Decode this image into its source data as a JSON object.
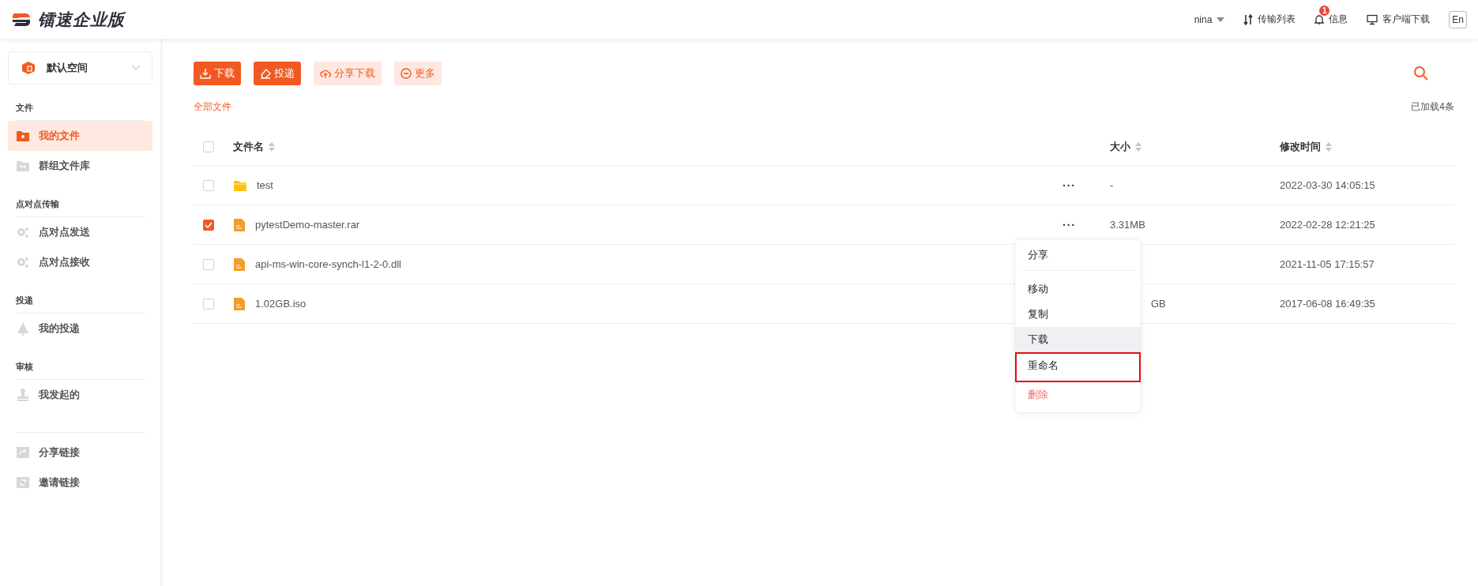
{
  "header": {
    "logo_text": "镭速企业版",
    "user": "nina",
    "links": [
      {
        "kind": "transfer",
        "label": "传输列表"
      },
      {
        "kind": "messages",
        "label": "信息",
        "badge": "1"
      },
      {
        "kind": "client",
        "label": "客户端下载"
      }
    ],
    "language": "En"
  },
  "sidebar": {
    "space": "默认空间",
    "groups": [
      {
        "title": "文件",
        "items": [
          {
            "label": "我的文件",
            "selected": true
          },
          {
            "label": "群组文件库",
            "selected": false
          }
        ]
      },
      {
        "title": "点对点传输",
        "items": [
          {
            "label": "点对点发送",
            "selected": false
          },
          {
            "label": "点对点接收",
            "selected": false
          }
        ]
      },
      {
        "title": "投递",
        "items": [
          {
            "label": "我的投递",
            "selected": false
          }
        ]
      },
      {
        "title": "审核",
        "items": [
          {
            "label": "我发起的",
            "selected": false
          }
        ]
      },
      {
        "items": [
          {
            "label": "分享链接",
            "selected": false
          },
          {
            "label": "邀请链接",
            "selected": false
          }
        ]
      }
    ]
  },
  "toolbar": {
    "buttons": [
      {
        "label": "下载",
        "kind": "primary"
      },
      {
        "label": "投递",
        "kind": "primary"
      },
      {
        "label": "分享下载",
        "kind": "secondary"
      },
      {
        "label": "更多",
        "kind": "secondary"
      }
    ]
  },
  "breadcrumb": "全部文件",
  "loaded_count": "已加载4条",
  "table": {
    "columns": [
      "文件名",
      "大小",
      "修改时间"
    ],
    "all_checked": false,
    "rows": [
      {
        "kind": "folder",
        "name": "test",
        "size": "-",
        "modified": "2022-03-30 14:05:15",
        "checked": false,
        "more": "···"
      },
      {
        "kind": "file",
        "name": "pytestDemo-master.rar",
        "size": "3.31MB",
        "modified": "2022-02-28 12:21:25",
        "checked": true,
        "more": "···"
      },
      {
        "kind": "file",
        "name": "api-ms-win-core-synch-l1-2-0.dll",
        "modified": "2021-11-05 17:15:57",
        "checked": false
      },
      {
        "kind": "file",
        "name": "1.02GB.iso",
        "size": "GB",
        "size_partial": true,
        "modified": "2017-06-08 16:49:35",
        "checked": false
      }
    ]
  },
  "context_menu": {
    "items": [
      {
        "kind": "item",
        "label": "分享",
        "hovered": false,
        "highlighted": false
      },
      {
        "kind": "divider"
      },
      {
        "kind": "item",
        "label": "移动",
        "hovered": false,
        "highlighted": false
      },
      {
        "kind": "item",
        "label": "复制",
        "hovered": false,
        "highlighted": false
      },
      {
        "kind": "item",
        "label": "下载",
        "hovered": true,
        "highlighted": false
      },
      {
        "kind": "item",
        "label": "重命名",
        "hovered": false,
        "highlighted": true
      },
      {
        "kind": "danger",
        "label": "删除",
        "hovered": false,
        "highlighted": false
      }
    ]
  }
}
